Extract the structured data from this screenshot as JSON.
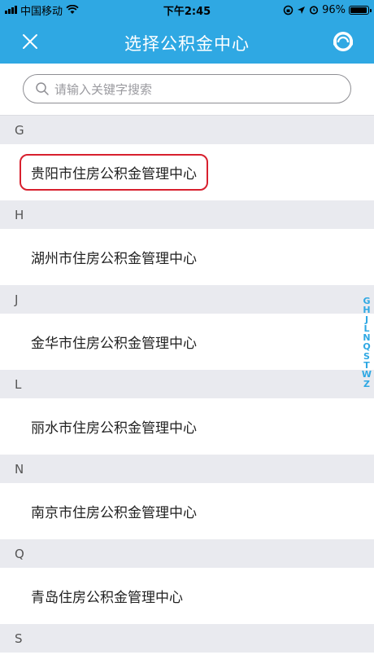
{
  "status_bar": {
    "carrier": "中国移动",
    "time": "下午2:45",
    "battery": "96%",
    "battery_level": 0.96
  },
  "nav": {
    "title": "选择公积金中心",
    "close_icon": "close-icon",
    "service_icon": "customer-service-icon"
  },
  "search": {
    "placeholder": "请输入关键字搜索",
    "icon": "search-icon"
  },
  "sections": [
    {
      "letter": "G",
      "items": [
        "贵阳市住房公积金管理中心"
      ]
    },
    {
      "letter": "H",
      "items": [
        "湖州市住房公积金管理中心"
      ]
    },
    {
      "letter": "J",
      "items": [
        "金华市住房公积金管理中心"
      ]
    },
    {
      "letter": "L",
      "items": [
        "丽水市住房公积金管理中心"
      ]
    },
    {
      "letter": "N",
      "items": [
        "南京市住房公积金管理中心"
      ]
    },
    {
      "letter": "Q",
      "items": [
        "青岛住房公积金管理中心"
      ]
    },
    {
      "letter": "S",
      "items": []
    }
  ],
  "index_letters": [
    "G",
    "H",
    "J",
    "L",
    "N",
    "Q",
    "S",
    "T",
    "W",
    "Z"
  ],
  "colors": {
    "accent": "#2fa8e3",
    "highlight_border": "#d8202e",
    "section_bg": "#e9eaef"
  }
}
